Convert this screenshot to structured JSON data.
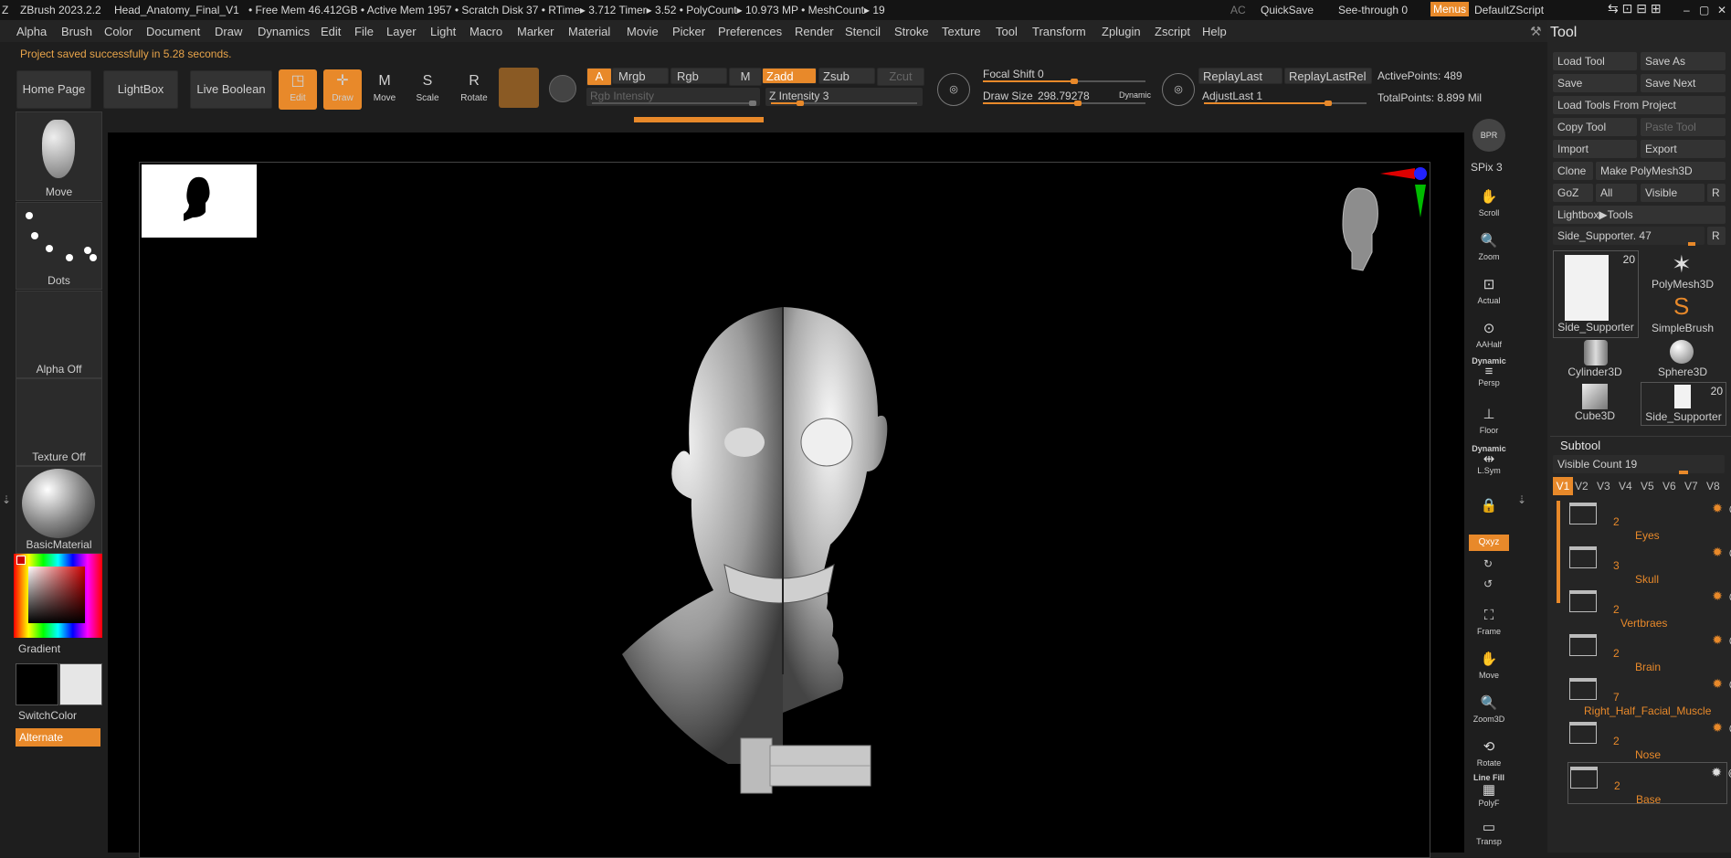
{
  "titlebar": {
    "app": "ZBrush 2023.2.2",
    "file": "Head_Anatomy_Final_V1",
    "stats": "• Free Mem 46.412GB • Active Mem 1957 • Scratch Disk 37 •  RTime▸ 3.712 Timer▸ 3.52 • PolyCount▸ 10.973 MP  • MeshCount▸ 19",
    "ac": "AC",
    "quicksave": "QuickSave",
    "see_through": "See-through  0",
    "menus": "Menus",
    "script": "DefaultZScript"
  },
  "menu": [
    "Alpha",
    "Brush",
    "Color",
    "Document",
    "Draw",
    "Dynamics",
    "Edit",
    "File",
    "Layer",
    "Light",
    "Macro",
    "Marker",
    "Material",
    "Movie",
    "Picker",
    "Preferences",
    "Render",
    "Stencil",
    "Stroke",
    "Texture",
    "Tool",
    "Transform",
    "Zplugin",
    "Zscript",
    "Help"
  ],
  "status_message": "Project saved successfully in 5.28 seconds.",
  "shelf": {
    "home": "Home Page",
    "lightbox": "LightBox",
    "live_boolean": "Live Boolean",
    "edit": "Edit",
    "draw": "Draw",
    "move": "Move",
    "scale": "Scale",
    "rotate": "Rotate",
    "a": "A",
    "mrgb": "Mrgb",
    "rgb": "Rgb",
    "m": "M",
    "zadd": "Zadd",
    "zsub": "Zsub",
    "zcut": "Zcut",
    "rgb_intensity": "Rgb Intensity",
    "z_intensity": "Z Intensity 3",
    "focal_shift": "Focal Shift 0",
    "draw_size_label": "Draw Size",
    "draw_size_value": "298.79278",
    "dynamic": "Dynamic",
    "replay_last": "ReplayLast",
    "replay_last_rel": "ReplayLastRel",
    "adjust_last": "AdjustLast 1",
    "active_points": "ActivePoints: 489",
    "total_points": "TotalPoints: 8.899 Mil"
  },
  "left": {
    "move": "Move",
    "dots": "Dots",
    "alpha_off": "Alpha Off",
    "texture_off": "Texture Off",
    "material": "BasicMaterial",
    "gradient": "Gradient",
    "switch_color": "SwitchColor",
    "alternate": "Alternate"
  },
  "right_shelf": {
    "bpr": "BPR",
    "spix": "SPix 3",
    "scroll": "Scroll",
    "zoom": "Zoom",
    "actual": "Actual",
    "aahalf": "AAHalf",
    "dynamic": "Dynamic",
    "persp": "Persp",
    "floor": "Floor",
    "dynamic2": "Dynamic",
    "lsym": "L.Sym",
    "xyz": "Qxyz",
    "frame": "Frame",
    "move": "Move",
    "zoom3d": "Zoom3D",
    "rotate": "Rotate",
    "linefill": "Line Fill",
    "polyf": "PolyF",
    "transp": "Transp"
  },
  "tool": {
    "title": "Tool",
    "load_tool": "Load Tool",
    "save_as": "Save As",
    "save": "Save",
    "save_next": "Save Next",
    "load_from_project": "Load Tools From Project",
    "copy_tool": "Copy Tool",
    "paste_tool": "Paste Tool",
    "import": "Import",
    "export": "Export",
    "clone": "Clone",
    "make_polymesh": "Make PolyMesh3D",
    "goz": "GoZ",
    "all": "All",
    "visible": "Visible",
    "r": "R",
    "lightbox_tools": "Lightbox▶Tools",
    "current_tool": "Side_Supporter. 47",
    "thumbs": [
      {
        "name": "Side_Supporter",
        "badge": "20"
      },
      {
        "name": "PolyMesh3D",
        "badge": ""
      },
      {
        "name": "SimpleBrush",
        "badge": ""
      },
      {
        "name": "Cylinder3D",
        "badge": ""
      },
      {
        "name": "Sphere3D",
        "badge": ""
      },
      {
        "name": "Cube3D",
        "badge": ""
      },
      {
        "name": "Side_Supporter",
        "badge": "20"
      }
    ],
    "subtool_title": "Subtool",
    "visible_count": "Visible Count 19",
    "versions": [
      "V1",
      "V2",
      "V3",
      "V4",
      "V5",
      "V6",
      "V7",
      "V8"
    ],
    "subtools": [
      {
        "count": "2",
        "name": "Eyes"
      },
      {
        "count": "3",
        "name": "Skull"
      },
      {
        "count": "2",
        "name": "Vertbraes"
      },
      {
        "count": "2",
        "name": "Brain"
      },
      {
        "count": "7",
        "name": "Right_Half_Facial_Muscle"
      },
      {
        "count": "2",
        "name": "Nose"
      },
      {
        "count": "2",
        "name": "Base"
      }
    ]
  },
  "colors": {
    "accent": "#e8892a",
    "panel": "#252525",
    "canvas": "#000000"
  }
}
